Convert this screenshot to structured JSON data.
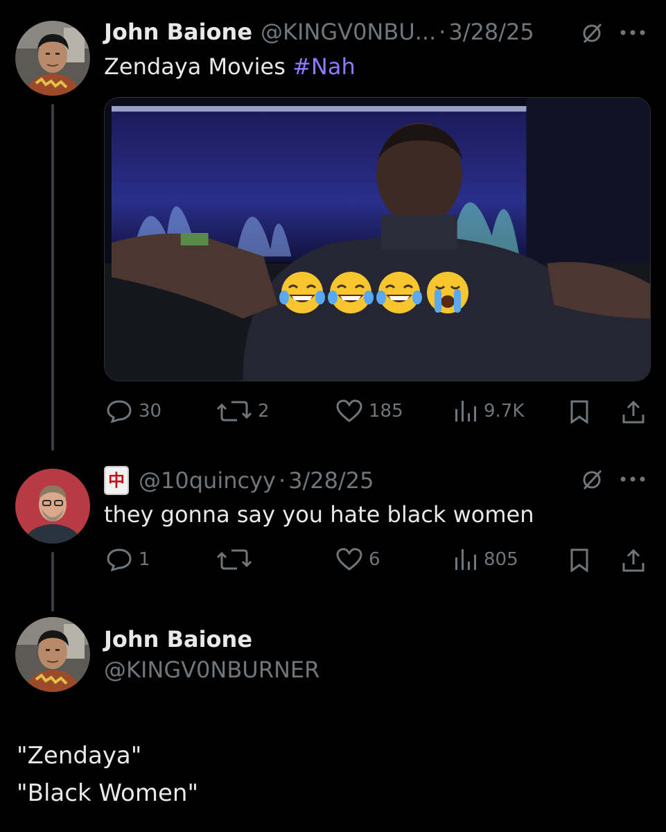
{
  "post1": {
    "author_name": "John Baione",
    "author_handle": "@KINGV0NBU...",
    "separator": "·",
    "date": "3/28/25",
    "text": "Zendaya Movies",
    "hashtag": "#Nah",
    "media_emojis": [
      "😂",
      "😂",
      "😂",
      "😭"
    ],
    "actions": {
      "replies": "30",
      "reposts": "2",
      "likes": "185",
      "views": "9.7K"
    }
  },
  "post2": {
    "author_handle": "@10quincyy",
    "separator": "·",
    "date": "3/28/25",
    "badge_glyph": "中",
    "text": "they gonna say you hate black women",
    "actions": {
      "replies": "1",
      "reposts": "",
      "likes": "6",
      "views": "805"
    }
  },
  "post3": {
    "author_name": "John Baione",
    "author_handle": "@KINGV0NBURNER",
    "text_lines": [
      "\"Zendaya\"",
      "\"Black Women\""
    ]
  },
  "colors": {
    "background": "#000000",
    "text_primary": "#e7e9ea",
    "text_secondary": "#71767b",
    "hashtag": "#8c7cff",
    "thread_line": "#3a3d41"
  },
  "icons": [
    "more-icon",
    "grok-slash-icon",
    "reply-icon",
    "repost-icon",
    "like-icon",
    "views-icon",
    "bookmark-icon",
    "share-icon"
  ]
}
